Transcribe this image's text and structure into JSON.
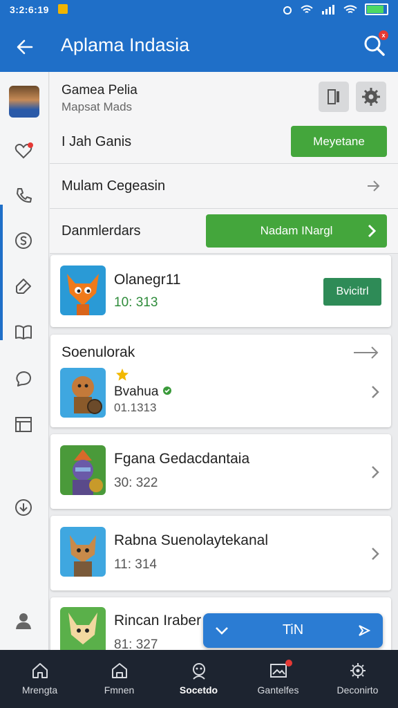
{
  "status": {
    "time": "3:2:6:19"
  },
  "appbar": {
    "title": "Aplama Indasia",
    "badge": "x"
  },
  "rows": {
    "r1": {
      "title": "Gamea Pelia",
      "subtitle": "Mapsat Mads"
    },
    "r2": {
      "title": "I Jah Ganis",
      "button": "Meyetane"
    },
    "r3": {
      "title": "Mulam Cegeasin"
    },
    "r4": {
      "title": "Danmlerdars",
      "button": "Nadam INargl"
    }
  },
  "cards": {
    "c1": {
      "name": "Olanegr11",
      "value": "10: 313",
      "button": "Bvicitrl"
    },
    "c2": {
      "header": "Soenulorak",
      "name": "Bvahua",
      "value": "01.1313"
    },
    "c3": {
      "name": "Fgana Gedacdantaia",
      "value": "30: 322"
    },
    "c4": {
      "name": "Rabna Suenolaytekanal",
      "value": "11: 314"
    },
    "c5": {
      "name": "Rincan Iraber",
      "value": "81: 327"
    }
  },
  "fab": {
    "label": "TiN"
  },
  "nav": [
    "Mrengta",
    "Fmnen",
    "Socetdo",
    "Gantelfes",
    "Deconirto"
  ],
  "colors": {
    "primary": "#1f6fc8",
    "green": "#44a63c",
    "navbg": "#1d2430"
  }
}
